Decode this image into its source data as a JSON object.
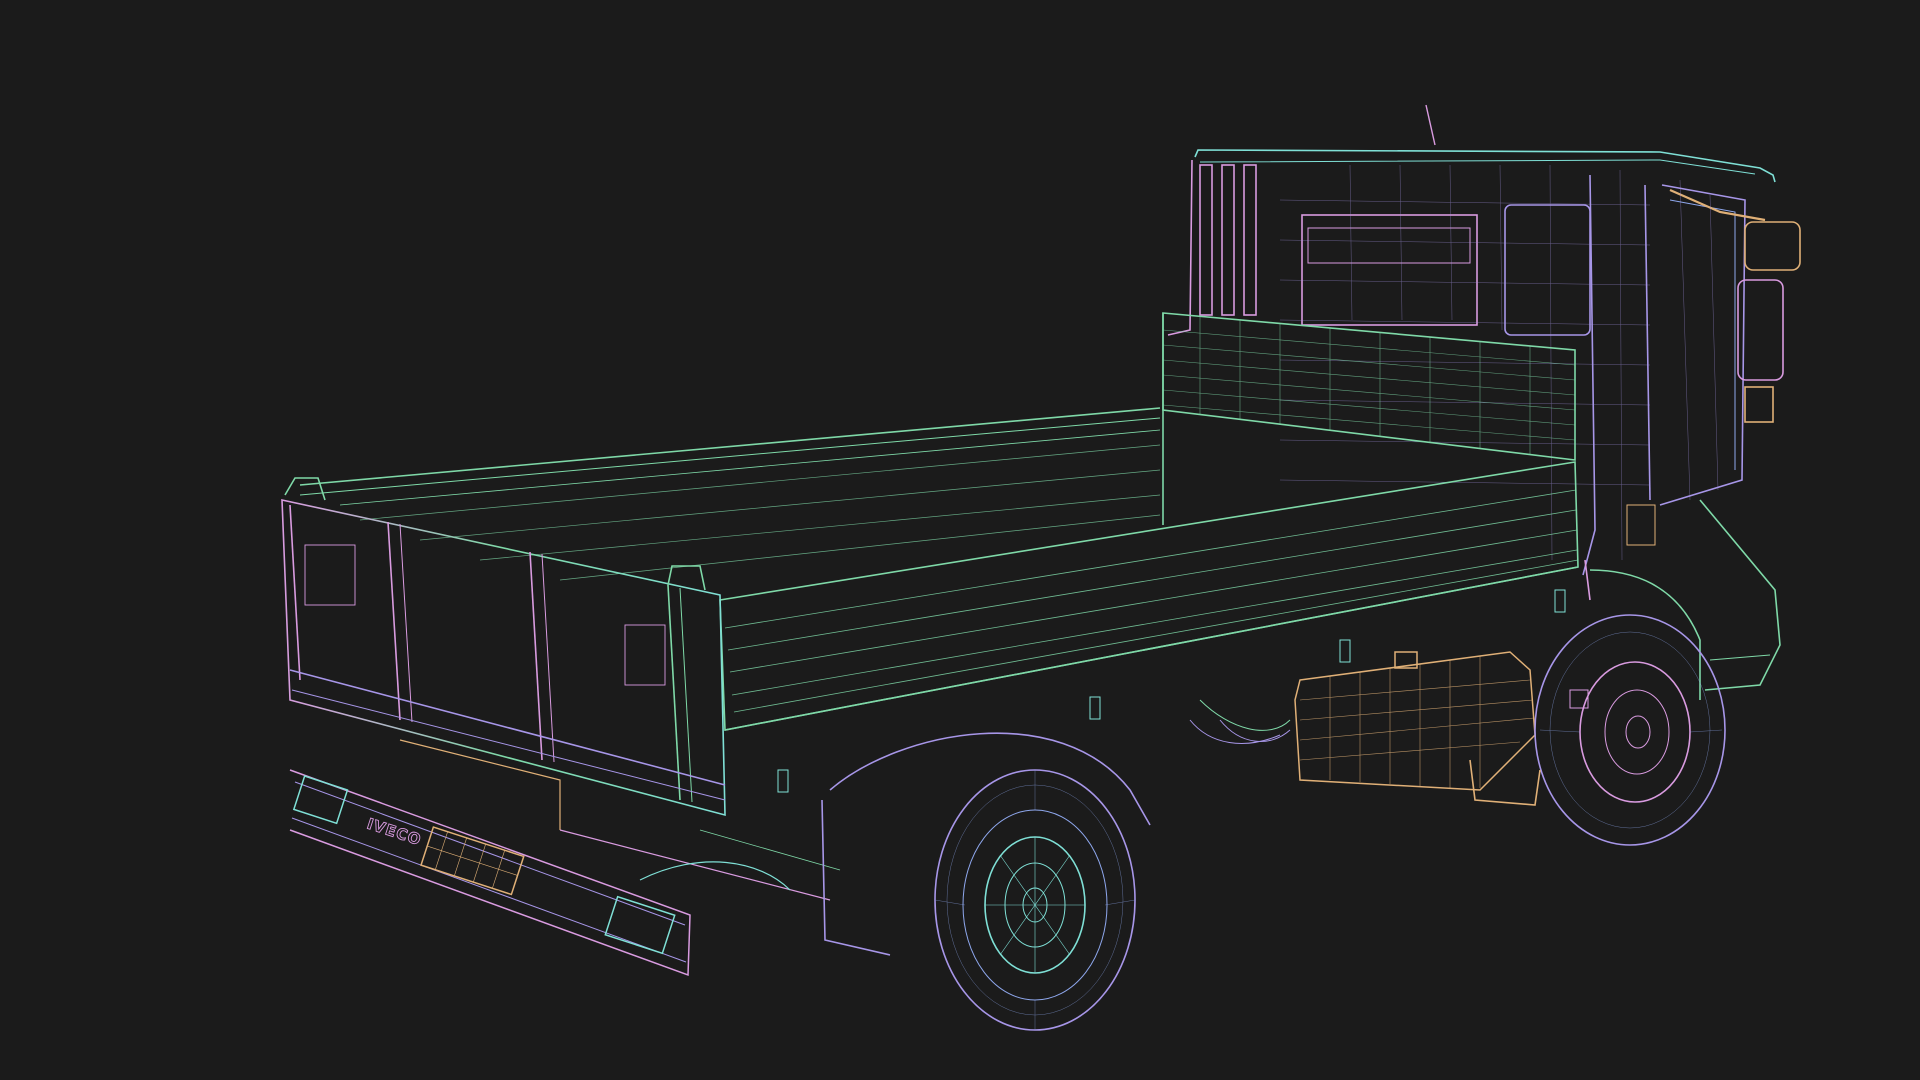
{
  "viewport": {
    "background": "#1b1b1b",
    "render_mode": "wireframe",
    "subject": "truck-3d-model"
  },
  "palette": {
    "green": "#7fd9a8",
    "teal": "#7fe0d6",
    "pink": "#d99be0",
    "purple": "#a796e8",
    "orange": "#e0b077",
    "blue": "#8fa8ee"
  },
  "model": {
    "brand_badge": "IVECO"
  }
}
